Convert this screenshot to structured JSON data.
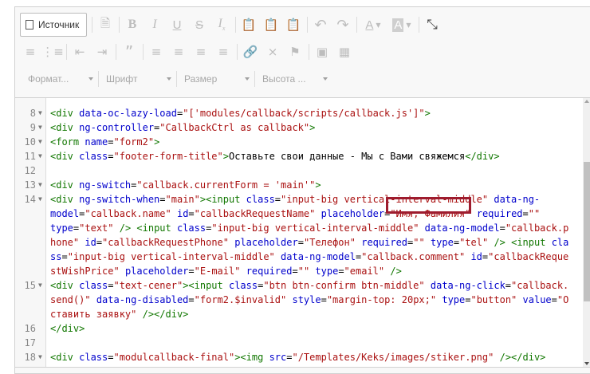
{
  "toolbar": {
    "source_label": "Источник",
    "format_label": "Формат...",
    "font_label": "Шрифт",
    "size_label": "Размер",
    "height_label": "Высота ..."
  },
  "code_lines": [
    {
      "num": "8",
      "fold": true,
      "parts": [
        [
          "tag",
          "<div "
        ],
        [
          "attr",
          "data-oc-lazy-load"
        ],
        [
          "plain",
          "="
        ],
        [
          "str",
          "\"['modules/callback/scripts/callback.js']\""
        ],
        [
          "tag",
          ">"
        ]
      ]
    },
    {
      "num": "9",
      "fold": true,
      "parts": [
        [
          "tag",
          "<div "
        ],
        [
          "attr",
          "ng-controller"
        ],
        [
          "plain",
          "="
        ],
        [
          "str",
          "\"CallbackCtrl as callback\""
        ],
        [
          "tag",
          ">"
        ]
      ]
    },
    {
      "num": "10",
      "fold": true,
      "parts": [
        [
          "tag",
          "<form "
        ],
        [
          "attr",
          "name"
        ],
        [
          "plain",
          "="
        ],
        [
          "str",
          "\"form2\""
        ],
        [
          "tag",
          ">"
        ]
      ]
    },
    {
      "num": "11",
      "fold": true,
      "parts": [
        [
          "tag",
          "<div "
        ],
        [
          "attr",
          "class"
        ],
        [
          "plain",
          "="
        ],
        [
          "str",
          "\"footer-form-title\""
        ],
        [
          "tag",
          ">"
        ],
        [
          "plain",
          "Оставьте свои данные - Мы с Вами свяжемся"
        ],
        [
          "tag",
          "</div>"
        ]
      ]
    },
    {
      "num": "12",
      "fold": false,
      "parts": []
    },
    {
      "num": "13",
      "fold": true,
      "parts": [
        [
          "tag",
          "<div "
        ],
        [
          "attr",
          "ng-switch"
        ],
        [
          "plain",
          "="
        ],
        [
          "str",
          "\"callback.currentForm = 'main'\""
        ],
        [
          "tag",
          ">"
        ]
      ]
    },
    {
      "num": "14",
      "fold": true,
      "parts": [
        [
          "tag",
          "<div "
        ],
        [
          "attr",
          "ng-switch-when"
        ],
        [
          "plain",
          "="
        ],
        [
          "str",
          "\"main\""
        ],
        [
          "tag",
          "><input "
        ],
        [
          "attr",
          "class"
        ],
        [
          "plain",
          "="
        ],
        [
          "str",
          "\"input-big vertical-interval-middle\""
        ],
        [
          "plain",
          " "
        ],
        [
          "attr",
          "data-ng-"
        ]
      ]
    },
    {
      "num": "",
      "fold": false,
      "parts": [
        [
          "attr",
          "model"
        ],
        [
          "plain",
          "="
        ],
        [
          "str",
          "\"callback.name\""
        ],
        [
          "plain",
          " "
        ],
        [
          "attr",
          "id"
        ],
        [
          "plain",
          "="
        ],
        [
          "str",
          "\"callbackRequestName\""
        ],
        [
          "plain",
          " "
        ],
        [
          "attr",
          "placeholder"
        ],
        [
          "plain",
          "="
        ],
        [
          "str",
          "\"Имя, Фамилия\""
        ],
        [
          "plain",
          " "
        ],
        [
          "attr",
          "required"
        ],
        [
          "plain",
          "="
        ],
        [
          "str",
          "\"\""
        ]
      ]
    },
    {
      "num": "",
      "fold": false,
      "parts": [
        [
          "attr",
          "type"
        ],
        [
          "plain",
          "="
        ],
        [
          "str",
          "\"text\""
        ],
        [
          "plain",
          " "
        ],
        [
          "tag",
          "/> <input "
        ],
        [
          "attr",
          "class"
        ],
        [
          "plain",
          "="
        ],
        [
          "str",
          "\"input-big vertical-interval-middle\""
        ],
        [
          "plain",
          " "
        ],
        [
          "attr",
          "data-ng-model"
        ],
        [
          "plain",
          "="
        ],
        [
          "str",
          "\"callback.p"
        ]
      ]
    },
    {
      "num": "",
      "fold": false,
      "parts": [
        [
          "str",
          "hone\""
        ],
        [
          "plain",
          " "
        ],
        [
          "attr",
          "id"
        ],
        [
          "plain",
          "="
        ],
        [
          "str",
          "\"callbackRequestPhone\""
        ],
        [
          "plain",
          " "
        ],
        [
          "attr",
          "placeholder"
        ],
        [
          "plain",
          "="
        ],
        [
          "str",
          "\"Телефон\""
        ],
        [
          "plain",
          " "
        ],
        [
          "attr",
          "required"
        ],
        [
          "plain",
          "="
        ],
        [
          "str",
          "\"\""
        ],
        [
          "plain",
          " "
        ],
        [
          "attr",
          "type"
        ],
        [
          "plain",
          "="
        ],
        [
          "str",
          "\"tel\""
        ],
        [
          "plain",
          " "
        ],
        [
          "tag",
          "/> <input "
        ],
        [
          "attr",
          "cla"
        ]
      ]
    },
    {
      "num": "",
      "fold": false,
      "parts": [
        [
          "attr",
          "ss"
        ],
        [
          "plain",
          "="
        ],
        [
          "str",
          "\"input-big vertical-interval-middle\""
        ],
        [
          "plain",
          " "
        ],
        [
          "attr",
          "data-ng-model"
        ],
        [
          "plain",
          "="
        ],
        [
          "str",
          "\"callback.comment\""
        ],
        [
          "plain",
          " "
        ],
        [
          "attr",
          "id"
        ],
        [
          "plain",
          "="
        ],
        [
          "str",
          "\"callbackReque"
        ]
      ]
    },
    {
      "num": "",
      "fold": false,
      "parts": [
        [
          "str",
          "stWishPrice\""
        ],
        [
          "plain",
          " "
        ],
        [
          "attr",
          "placeholder"
        ],
        [
          "plain",
          "="
        ],
        [
          "str",
          "\"E-mail\""
        ],
        [
          "plain",
          " "
        ],
        [
          "attr",
          "required"
        ],
        [
          "plain",
          "="
        ],
        [
          "str",
          "\"\""
        ],
        [
          "plain",
          " "
        ],
        [
          "attr",
          "type"
        ],
        [
          "plain",
          "="
        ],
        [
          "str",
          "\"email\""
        ],
        [
          "plain",
          " "
        ],
        [
          "tag",
          "/>"
        ]
      ]
    },
    {
      "num": "15",
      "fold": true,
      "parts": [
        [
          "tag",
          "<div "
        ],
        [
          "attr",
          "class"
        ],
        [
          "plain",
          "="
        ],
        [
          "str",
          "\"text-cener\""
        ],
        [
          "tag",
          "><input "
        ],
        [
          "attr",
          "class"
        ],
        [
          "plain",
          "="
        ],
        [
          "str",
          "\"btn btn-confirm btn-middle\""
        ],
        [
          "plain",
          " "
        ],
        [
          "attr",
          "data-ng-click"
        ],
        [
          "plain",
          "="
        ],
        [
          "str",
          "\"callback."
        ]
      ]
    },
    {
      "num": "",
      "fold": false,
      "parts": [
        [
          "str",
          "send()\""
        ],
        [
          "plain",
          " "
        ],
        [
          "attr",
          "data-ng-disabled"
        ],
        [
          "plain",
          "="
        ],
        [
          "str",
          "\"form2.$invalid\""
        ],
        [
          "plain",
          " "
        ],
        [
          "attr",
          "style"
        ],
        [
          "plain",
          "="
        ],
        [
          "str",
          "\"margin-top: 20px;\""
        ],
        [
          "plain",
          " "
        ],
        [
          "attr",
          "type"
        ],
        [
          "plain",
          "="
        ],
        [
          "str",
          "\"button\""
        ],
        [
          "plain",
          " "
        ],
        [
          "attr",
          "value"
        ],
        [
          "plain",
          "="
        ],
        [
          "str",
          "\"О"
        ]
      ]
    },
    {
      "num": "",
      "fold": false,
      "parts": [
        [
          "str",
          "ставить заявку\""
        ],
        [
          "plain",
          " "
        ],
        [
          "tag",
          "/></div>"
        ]
      ]
    },
    {
      "num": "16",
      "fold": false,
      "parts": [
        [
          "tag",
          "</div>"
        ]
      ]
    },
    {
      "num": "17",
      "fold": false,
      "parts": []
    },
    {
      "num": "18",
      "fold": true,
      "parts": [
        [
          "tag",
          "<div "
        ],
        [
          "attr",
          "class"
        ],
        [
          "plain",
          "="
        ],
        [
          "str",
          "\"modulcallback-final\""
        ],
        [
          "tag",
          "><img "
        ],
        [
          "attr",
          "src"
        ],
        [
          "plain",
          "="
        ],
        [
          "str",
          "\"/Templates/Keks/images/stiker.png\""
        ],
        [
          "plain",
          " "
        ],
        [
          "tag",
          "/></div>"
        ]
      ]
    }
  ]
}
